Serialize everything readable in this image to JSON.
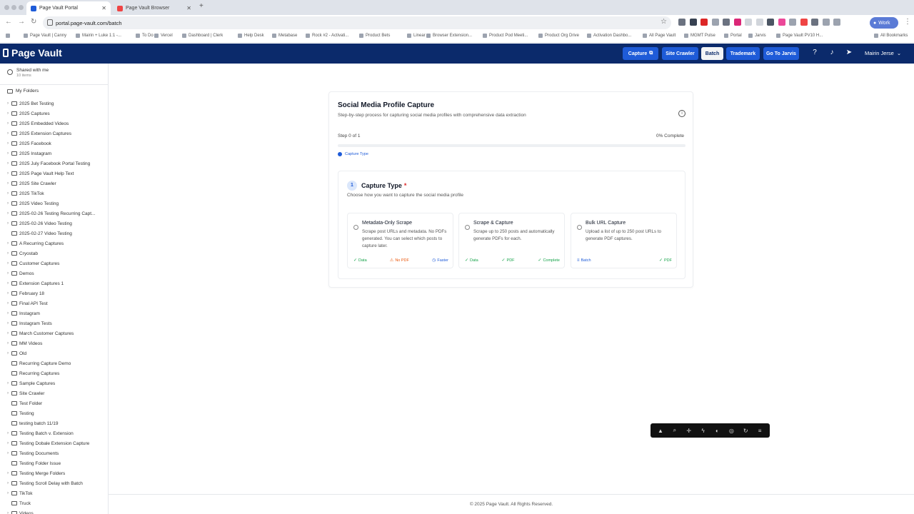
{
  "browser": {
    "tabs": [
      {
        "label": "Page Vault Portal",
        "active": true
      },
      {
        "label": "Page Vault Browser",
        "active": false
      }
    ],
    "url": "portal.page-vault.com/batch",
    "profile": "Work",
    "bookmarks": [
      "Page Vault | Canny",
      "Mairin + Luke 1:1 -...",
      "To Do",
      "Vercel",
      "Dashboard | Clerk",
      "Help Desk",
      "Metabase",
      "Rock #2 - Activati...",
      "Product Bets",
      "Linear",
      "Browser Extension...",
      "Product Pod Meeti...",
      "Product Org Drive",
      "Activation Dashbo...",
      "All Page Vault",
      "MGMT Pulse",
      "Portal",
      "Jarvis",
      "Page Vault PV10 H...",
      "All Bookmarks"
    ]
  },
  "header": {
    "logo": "Page Vault",
    "buttons": {
      "capture": "Capture",
      "site_crawler": "Site Crawler",
      "batch": "Batch",
      "trademark": "Trademark",
      "jarvis": "Go To Jarvis"
    },
    "user": "Mairin Jerse"
  },
  "sidebar": {
    "shared_label": "Shared with me",
    "shared_count": "10 items",
    "my_folders": "My Folders",
    "folders": [
      {
        "name": "2025 Bet Testing",
        "chev": true
      },
      {
        "name": "2025 Captures",
        "chev": true
      },
      {
        "name": "2025 Embedded Videos",
        "chev": true
      },
      {
        "name": "2025 Extension Captures",
        "chev": true
      },
      {
        "name": "2025 Facebook",
        "chev": true
      },
      {
        "name": "2025 Instagram",
        "chev": true
      },
      {
        "name": "2025 July Facebook Portal Testing",
        "chev": true
      },
      {
        "name": "2025 Page Vault Help Text",
        "chev": true
      },
      {
        "name": "2025 Site Crawler",
        "chev": true
      },
      {
        "name": "2025 TikTok",
        "chev": true
      },
      {
        "name": "2025 Video Testing",
        "chev": true
      },
      {
        "name": "2025-02-26 Testing Recurring Capt...",
        "chev": true
      },
      {
        "name": "2025-02-26 Video Testing",
        "chev": true
      },
      {
        "name": "2025-02-27 Video Testing",
        "chev": false
      },
      {
        "name": "A Recurring Captures",
        "chev": true
      },
      {
        "name": "Cryostab",
        "chev": true
      },
      {
        "name": "Customer Captures",
        "chev": true
      },
      {
        "name": "Demos",
        "chev": true
      },
      {
        "name": "Extension Captures 1",
        "chev": true
      },
      {
        "name": "February 18",
        "chev": true
      },
      {
        "name": "Final API Test",
        "chev": true
      },
      {
        "name": "Instagram",
        "chev": true
      },
      {
        "name": "Instagram Tests",
        "chev": true
      },
      {
        "name": "March Customer Captures",
        "chev": true
      },
      {
        "name": "MM Videos",
        "chev": true
      },
      {
        "name": "Old",
        "chev": true
      },
      {
        "name": "Recurring Capture Demo",
        "chev": false
      },
      {
        "name": "Recurring Captures",
        "chev": false
      },
      {
        "name": "Sample Captures",
        "chev": true
      },
      {
        "name": "Site Crawler",
        "chev": true
      },
      {
        "name": "Test Folder",
        "chev": false
      },
      {
        "name": "Testing",
        "chev": false
      },
      {
        "name": "testing batch 11/19",
        "chev": false
      },
      {
        "name": "Testing Batch v. Extension",
        "chev": true
      },
      {
        "name": "Testing Dobale Extension Capture",
        "chev": true
      },
      {
        "name": "Testing Documents",
        "chev": true
      },
      {
        "name": "Testing Folder Issue",
        "chev": false
      },
      {
        "name": "Testing Merge Folders",
        "chev": true
      },
      {
        "name": "Testing Scroll Delay with Batch",
        "chev": true
      },
      {
        "name": "TikTok",
        "chev": true
      },
      {
        "name": "Truck",
        "chev": false
      },
      {
        "name": "Videos",
        "chev": true
      }
    ]
  },
  "main": {
    "title": "Social Media Profile Capture",
    "subtitle": "Step-by-step process for capturing social media profiles with comprehensive data extraction",
    "step_text": "Step 0 of 1",
    "complete_text": "0% Complete",
    "progress": 0,
    "step_label": "Capture Type",
    "section": {
      "number": "1",
      "title": "Capture Type",
      "required": "*",
      "subtitle": "Choose how you want to capture the social media profile",
      "options": [
        {
          "title": "Metadata-Only Scrape",
          "desc": "Scrape post URLs and metadata. No PDFs generated. You can select which posts to capture later.",
          "tags": [
            {
              "label": "Data",
              "color": "green",
              "icon": "check-circle-icon"
            },
            {
              "label": "No PDF",
              "color": "orange",
              "icon": "warning-icon"
            },
            {
              "label": "Faster",
              "color": "blue",
              "icon": "clock-icon"
            }
          ]
        },
        {
          "title": "Scrape & Capture",
          "desc": "Scrape up to 250 posts and automatically generate PDFs for each.",
          "tags": [
            {
              "label": "Data",
              "color": "green",
              "icon": "check-circle-icon"
            },
            {
              "label": "PDF",
              "color": "green",
              "icon": "check-circle-icon"
            },
            {
              "label": "Complete",
              "color": "green",
              "icon": "check-circle-icon"
            }
          ]
        },
        {
          "title": "Bulk URL Capture",
          "desc": "Upload a list of up to 250 post URLs to generate PDF captures.",
          "tags": [
            {
              "label": "Batch",
              "color": "blue",
              "icon": "list-icon"
            },
            {
              "label": "PDF",
              "color": "green",
              "icon": "check-circle-icon"
            }
          ]
        }
      ]
    }
  },
  "footer": "© 2025 Page Vault. All Rights Reserved."
}
